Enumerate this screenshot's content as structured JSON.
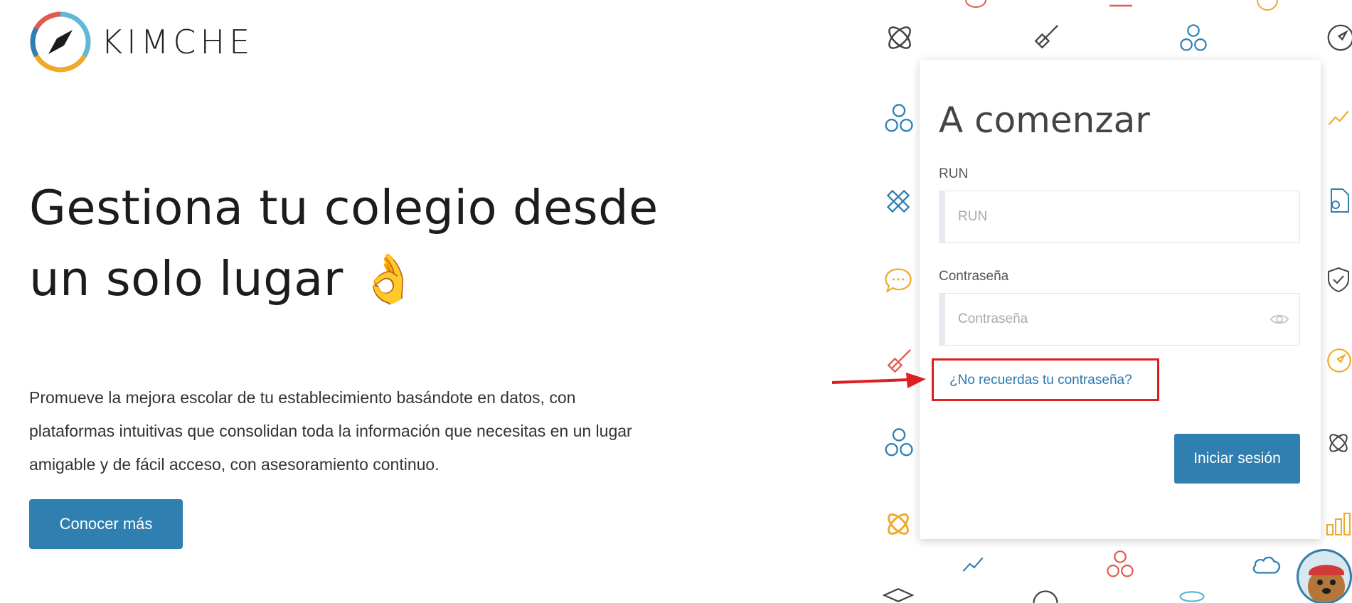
{
  "brand": {
    "name": "KIMCHE",
    "logo_icon": "compass-icon"
  },
  "hero": {
    "title": "Gestiona tu colegio desde un solo lugar 👌",
    "description": "Promueve la mejora escolar de tu establecimiento basándote en datos, con plataformas intuitivas que consolidan toda la información que necesitas en un lugar amigable y de fácil acceso, con asesoramiento continuo.",
    "cta_label": "Conocer más"
  },
  "login_card": {
    "title": "A comenzar",
    "run_label": "RUN",
    "run_placeholder": "RUN",
    "password_label": "Contraseña",
    "password_placeholder": "Contraseña",
    "forgot_password_link": "¿No recuerdas tu contraseña?",
    "submit_label": "Iniciar sesión"
  },
  "colors": {
    "primary": "#2f7fb0",
    "annotation_red": "#dd1f1f",
    "pattern_red": "#e05a4d",
    "pattern_blue": "#2e7fb3",
    "pattern_yellow": "#f0a928",
    "pattern_dark": "#444444"
  },
  "pattern_icons": [
    "atom-icon",
    "rocket-icon",
    "circles-icon",
    "compass-icon",
    "trend-up-icon",
    "pencil-ruler-icon",
    "certificate-icon",
    "chat-bubble-icon",
    "shield-check-icon",
    "bar-chart-icon",
    "graduation-cap-icon",
    "cloud-icon",
    "laptop-icon"
  ]
}
